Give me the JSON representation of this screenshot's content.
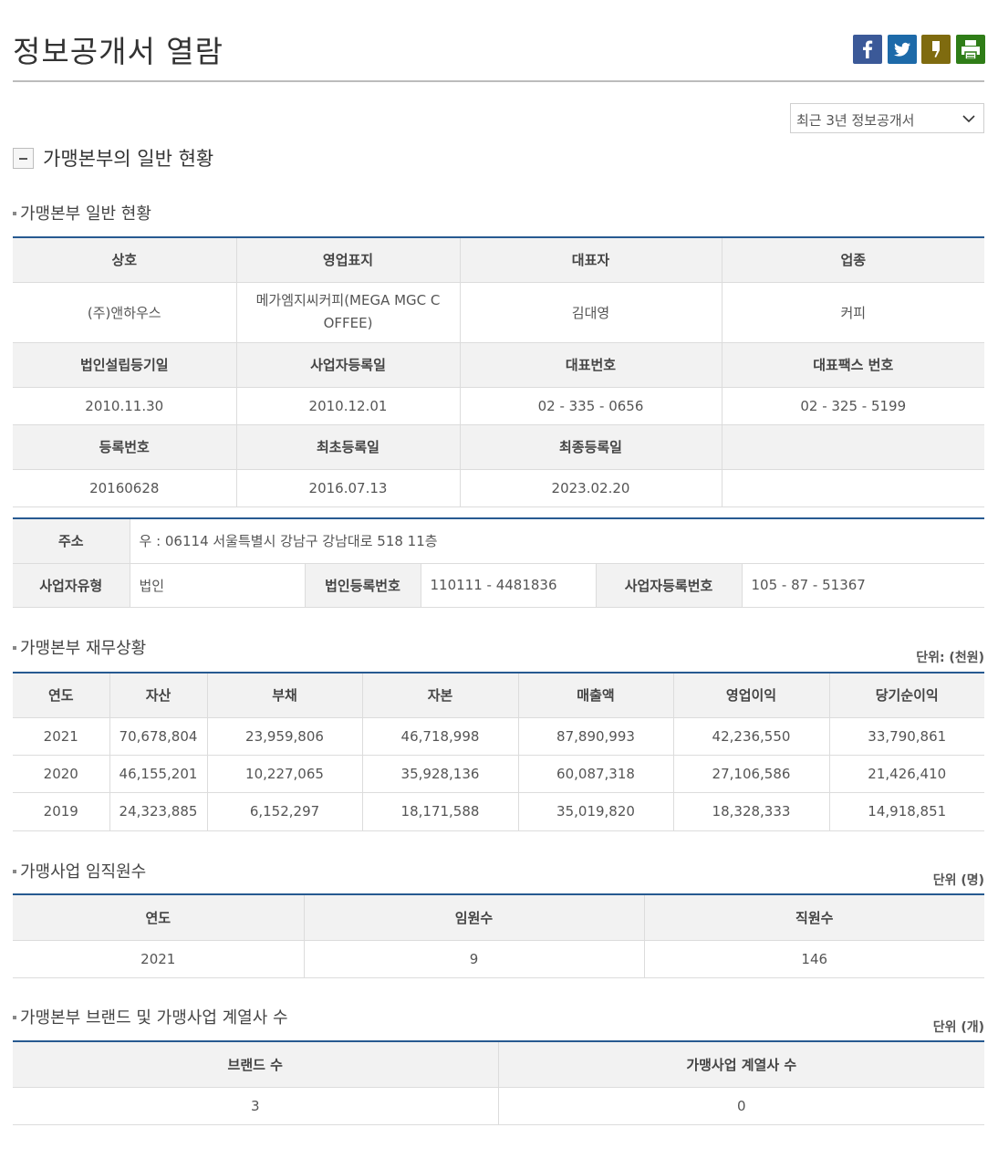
{
  "page": {
    "title": "정보공개서 열람"
  },
  "share_icons": [
    "facebook-icon",
    "twitter-icon",
    "bookmark-icon",
    "print-icon"
  ],
  "select": {
    "value": "최근 3년 정보공개서"
  },
  "section": {
    "title": "가맹본부의 일반 현황"
  },
  "general": {
    "title": "가맹본부 일반 현황",
    "h1": [
      "상호",
      "영업표지",
      "대표자",
      "업종"
    ],
    "r1": [
      "(주)앤하우스",
      "메가엠지씨커피(MEGA MGC C\nOFFEE)",
      "김대영",
      "커피"
    ],
    "h2": [
      "법인설립등기일",
      "사업자등록일",
      "대표번호",
      "대표팩스 번호"
    ],
    "r2": [
      "2010.11.30",
      "2010.12.01",
      "02 - 335 - 0656",
      "02 - 325 - 5199"
    ],
    "h3": [
      "등록번호",
      "최초등록일",
      "최종등록일",
      ""
    ],
    "r3": [
      "20160628",
      "2016.07.13",
      "2023.02.20",
      ""
    ]
  },
  "address": {
    "addr_label": "주소",
    "addr_value": "우 : 06114 서울특별시 강남구 강남대로 518 11층",
    "biz_type_label": "사업자유형",
    "biz_type_value": "법인",
    "corp_no_label": "법인등록번호",
    "corp_no_value": "110111 - 4481836",
    "biz_no_label": "사업자등록번호",
    "biz_no_value": "105 - 87 - 51367"
  },
  "finance": {
    "title": "가맹본부 재무상황",
    "unit": "단위: (천원)",
    "headers": [
      "연도",
      "자산",
      "부채",
      "자본",
      "매출액",
      "영업이익",
      "당기순이익"
    ],
    "rows": [
      [
        "2021",
        "70,678,804",
        "23,959,806",
        "46,718,998",
        "87,890,993",
        "42,236,550",
        "33,790,861"
      ],
      [
        "2020",
        "46,155,201",
        "10,227,065",
        "35,928,136",
        "60,087,318",
        "27,106,586",
        "21,426,410"
      ],
      [
        "2019",
        "24,323,885",
        "6,152,297",
        "18,171,588",
        "35,019,820",
        "18,328,333",
        "14,918,851"
      ]
    ]
  },
  "staff": {
    "title": "가맹사업 임직원수",
    "unit": "단위 (명)",
    "headers": [
      "연도",
      "임원수",
      "직원수"
    ],
    "row": [
      "2021",
      "9",
      "146"
    ]
  },
  "brands": {
    "title": "가맹본부 브랜드 및 가맹사업 계열사 수",
    "unit": "단위 (개)",
    "headers": [
      "브랜드 수",
      "가맹사업 계열사 수"
    ],
    "row": [
      "3",
      "0"
    ]
  }
}
